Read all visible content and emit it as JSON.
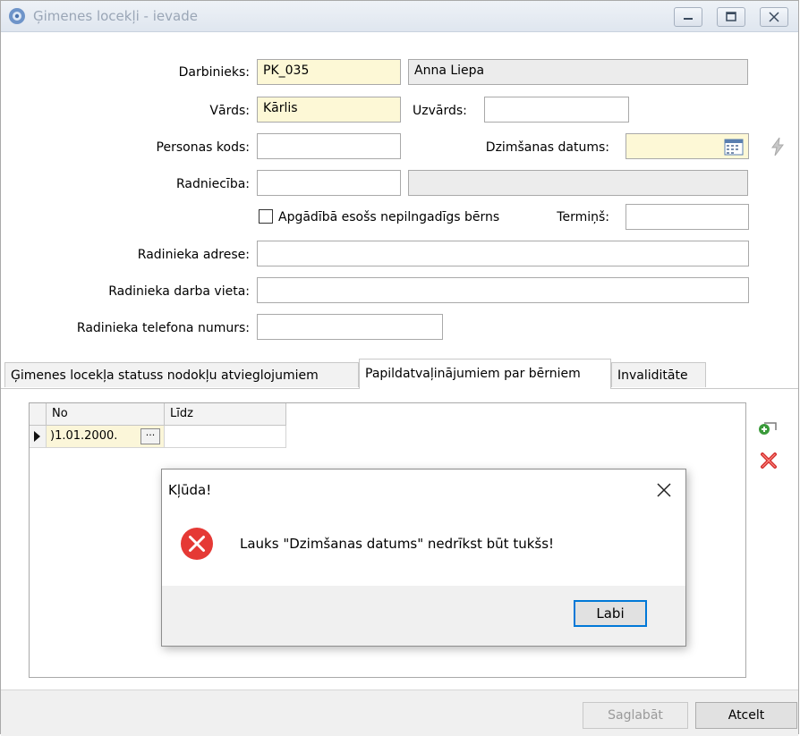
{
  "window": {
    "title": "Ģimenes locekļi - ievade",
    "minimize_icon": "minimize-icon",
    "maximize_icon": "maximize-icon",
    "close_icon": "close-icon"
  },
  "form": {
    "darbinieks": {
      "label": "Darbinieks:",
      "code": "PK_035",
      "name": "Anna Liepa"
    },
    "vards": {
      "label": "Vārds:",
      "value": "Kārlis"
    },
    "uzvards": {
      "label": "Uzvārds:",
      "value": ""
    },
    "personas_kods": {
      "label": "Personas kods:",
      "value": ""
    },
    "dzimsanas_datums": {
      "label": "Dzimšanas datums:",
      "value": "",
      "icon": "calendar-icon"
    },
    "radnieciba": {
      "label": "Radniecība:",
      "code": "",
      "name": ""
    },
    "apgadiba": {
      "label": "Apgādībā esošs nepilngadīgs bērns",
      "checked": false
    },
    "termins": {
      "label": "Termiņš:",
      "value": ""
    },
    "adrese": {
      "label": "Radinieka adrese:",
      "value": ""
    },
    "darba_vieta": {
      "label": "Radinieka darba vieta:",
      "value": ""
    },
    "telefons": {
      "label": "Radinieka telefona numurs:",
      "value": ""
    },
    "lightning_icon": "lightning-icon"
  },
  "tabs": [
    {
      "label": "Ģimenes locekļa statuss nodokļu atvieglojumiem",
      "active": false
    },
    {
      "label": "Papildatvaļinājumiem par bērniem",
      "active": true
    },
    {
      "label": "Invaliditāte",
      "active": false
    }
  ],
  "grid": {
    "columns": [
      "No",
      "Līdz"
    ],
    "rows": [
      {
        "no": ")1.01.2000.",
        "lidz": ""
      }
    ],
    "row_pointer_icon": "row-pointer-icon",
    "ellipsis": "···",
    "add_icon": "add-row-icon",
    "delete_icon": "delete-row-icon"
  },
  "footer": {
    "save_label": "Saglabāt",
    "cancel_label": "Atcelt",
    "save_disabled": true
  },
  "dialog": {
    "title": "Kļūda!",
    "message": "Lauks \"Dzimšanas datums\" nedrīkst būt tukšs!",
    "ok_label": "Labi",
    "error_icon": "error-icon",
    "close_icon": "close-icon",
    "accent": "#0078d7",
    "error_color": "#e53935"
  }
}
